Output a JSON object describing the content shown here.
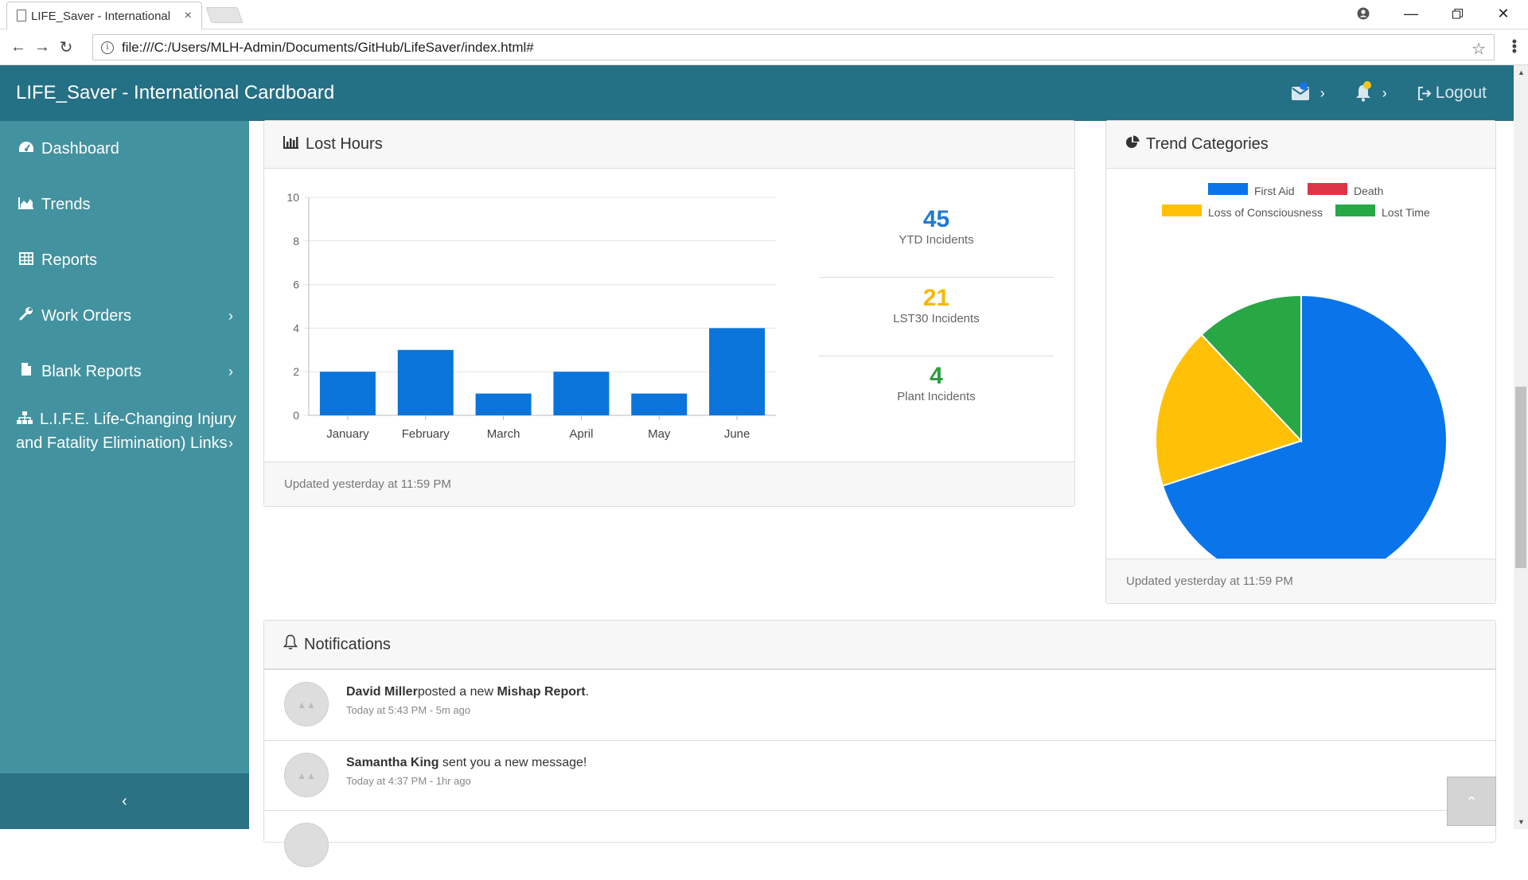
{
  "browser": {
    "tab_title": "LIFE_Saver - International",
    "tab_close": "×",
    "url": "file:///C:/Users/MLH-Admin/Documents/GitHub/LifeSaver/index.html#"
  },
  "header": {
    "brand": "LIFE_Saver - International Cardboard",
    "logout_label": "Logout",
    "mail_dot_color": "#1a73e8",
    "bell_dot_color": "#f5c518"
  },
  "sidebar": {
    "items": [
      {
        "label": "Dashboard",
        "icon": "dashboard-icon"
      },
      {
        "label": "Trends",
        "icon": "area-chart-icon"
      },
      {
        "label": "Reports",
        "icon": "table-icon"
      },
      {
        "label": "Work Orders",
        "icon": "wrench-icon"
      },
      {
        "label": "Blank Reports",
        "icon": "file-icon"
      },
      {
        "label_line1": "L.I.F.E. Life-Changing Injury",
        "label_line2": "and Fatality Elimination) Links",
        "icon": "sitemap-icon"
      }
    ]
  },
  "lost_hours": {
    "title": "Lost Hours",
    "footer": "Updated yesterday at 11:59 PM",
    "stats": [
      {
        "value": "45",
        "label": "YTD Incidents",
        "color": "#1f7ad6"
      },
      {
        "value": "21",
        "label": "LST30 Incidents",
        "color": "#f5b800"
      },
      {
        "value": "4",
        "label": "Plant Incidents",
        "color": "#2e9e3e"
      }
    ]
  },
  "trend_categories": {
    "title": "Trend Categories",
    "footer": "Updated yesterday at 11:59 PM"
  },
  "chart_data": [
    {
      "type": "bar",
      "title": "",
      "xlabel": "",
      "ylabel": "",
      "categories": [
        "January",
        "February",
        "March",
        "April",
        "May",
        "June"
      ],
      "values": [
        2,
        3,
        1,
        2,
        1,
        4
      ],
      "ylim": [
        0,
        10
      ],
      "yticks": [
        "0",
        "2",
        "4",
        "6",
        "8",
        "10"
      ],
      "color": "#0a74da",
      "grid": true
    },
    {
      "type": "pie",
      "title": "",
      "legend": [
        {
          "name": "First Aid",
          "color": "#0a74ea"
        },
        {
          "name": "Death",
          "color": "#dc3545"
        },
        {
          "name": "Loss of Consciousness",
          "color": "#ffc107"
        },
        {
          "name": "Lost Time",
          "color": "#28a745"
        }
      ],
      "legend_position": "top",
      "values": [
        70,
        0,
        18,
        12
      ]
    }
  ],
  "notifications": {
    "title": "Notifications",
    "items": [
      {
        "name": "David Miller",
        "text": "posted a new ",
        "link": "Mishap Report",
        "end": ".",
        "time": "Today at 5:43 PM - 5m ago"
      },
      {
        "name": "Samantha King",
        "text": " sent you a new message!",
        "link": "",
        "end": "",
        "time": "Today at 4:37 PM - 1hr ago"
      }
    ]
  }
}
